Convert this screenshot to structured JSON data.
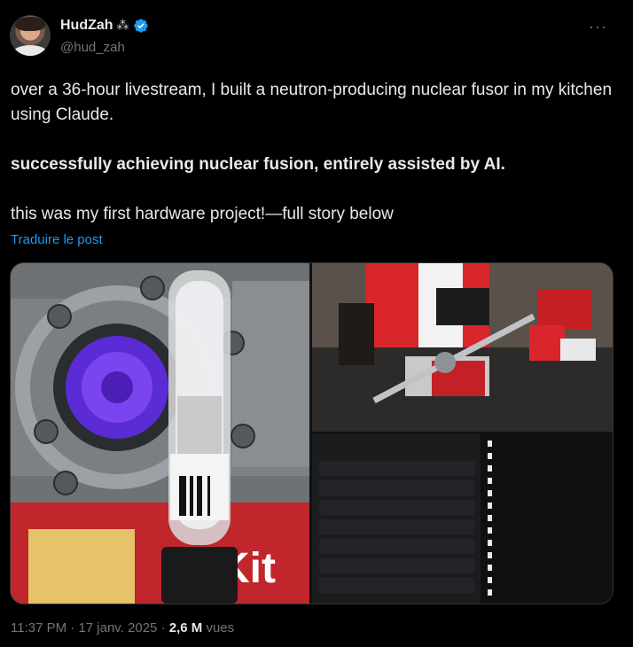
{
  "author": {
    "name": "HudZah",
    "name_emoji": "⁂",
    "handle": "@hud_zah",
    "verified": true
  },
  "more_icon": "more-horizontal-icon",
  "tweet": {
    "line1": "over a 36-hour livestream, I built a neutron-producing nuclear fusor in my kitchen using Claude.",
    "line2": "successfully achieving nuclear fusion, entirely assisted by AI.",
    "line3": "this was my first hardware project!—full story below",
    "translate_label": "Traduire le post"
  },
  "meta": {
    "time": "11:37 PM",
    "date": "17 janv. 2025",
    "separator": "·",
    "views_count": "2,6 M",
    "views_label": "vues"
  },
  "colors": {
    "background": "#000000",
    "text": "#e7e9ea",
    "muted": "#71767b",
    "link": "#1d9bf0",
    "verified": "#1d9bf0"
  }
}
